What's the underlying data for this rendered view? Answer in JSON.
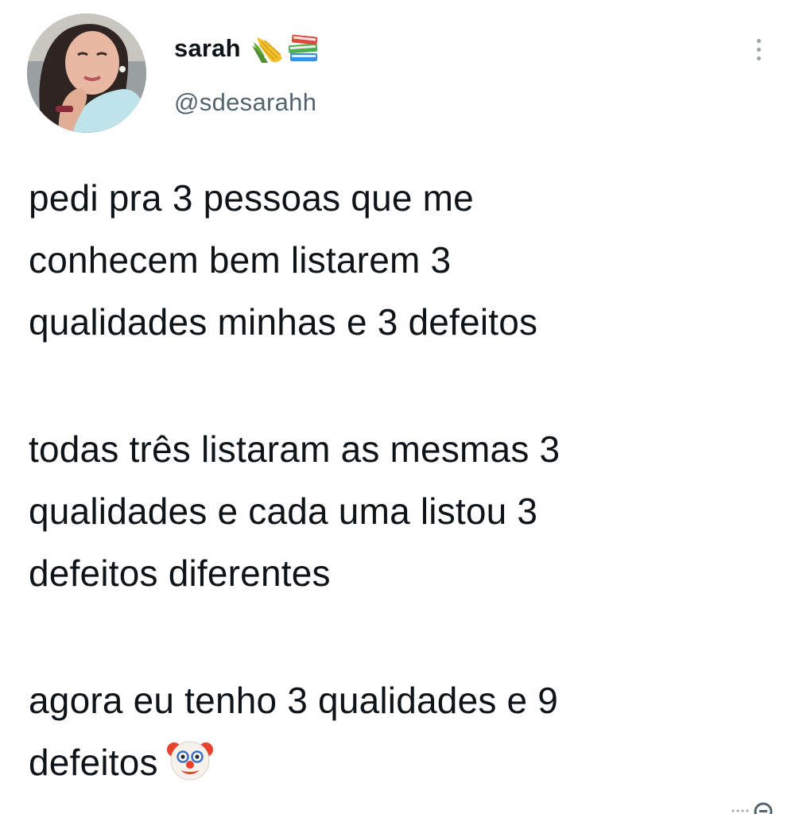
{
  "tweet": {
    "author": {
      "display_name": "sarah",
      "name_emojis": [
        "corn-icon",
        "books-icon"
      ],
      "handle": "@sdesarahh",
      "avatar": "avatar-photo"
    },
    "more_options_icon": "vertical-dots-icon",
    "text": {
      "paragraph1": {
        "line1": "pedi pra 3 pessoas que me",
        "line2": "conhecem bem listarem 3",
        "line3": "qualidades minhas e 3 defeitos"
      },
      "paragraph2": {
        "line1": "todas três listaram as mesmas 3",
        "line2": "qualidades e cada uma listou 3",
        "line3": "defeitos diferentes"
      },
      "paragraph3": {
        "line1": "agora eu tenho 3 qualidades e 9",
        "line2": "defeitos"
      },
      "trailing_emoji": "clown-face-icon"
    }
  }
}
